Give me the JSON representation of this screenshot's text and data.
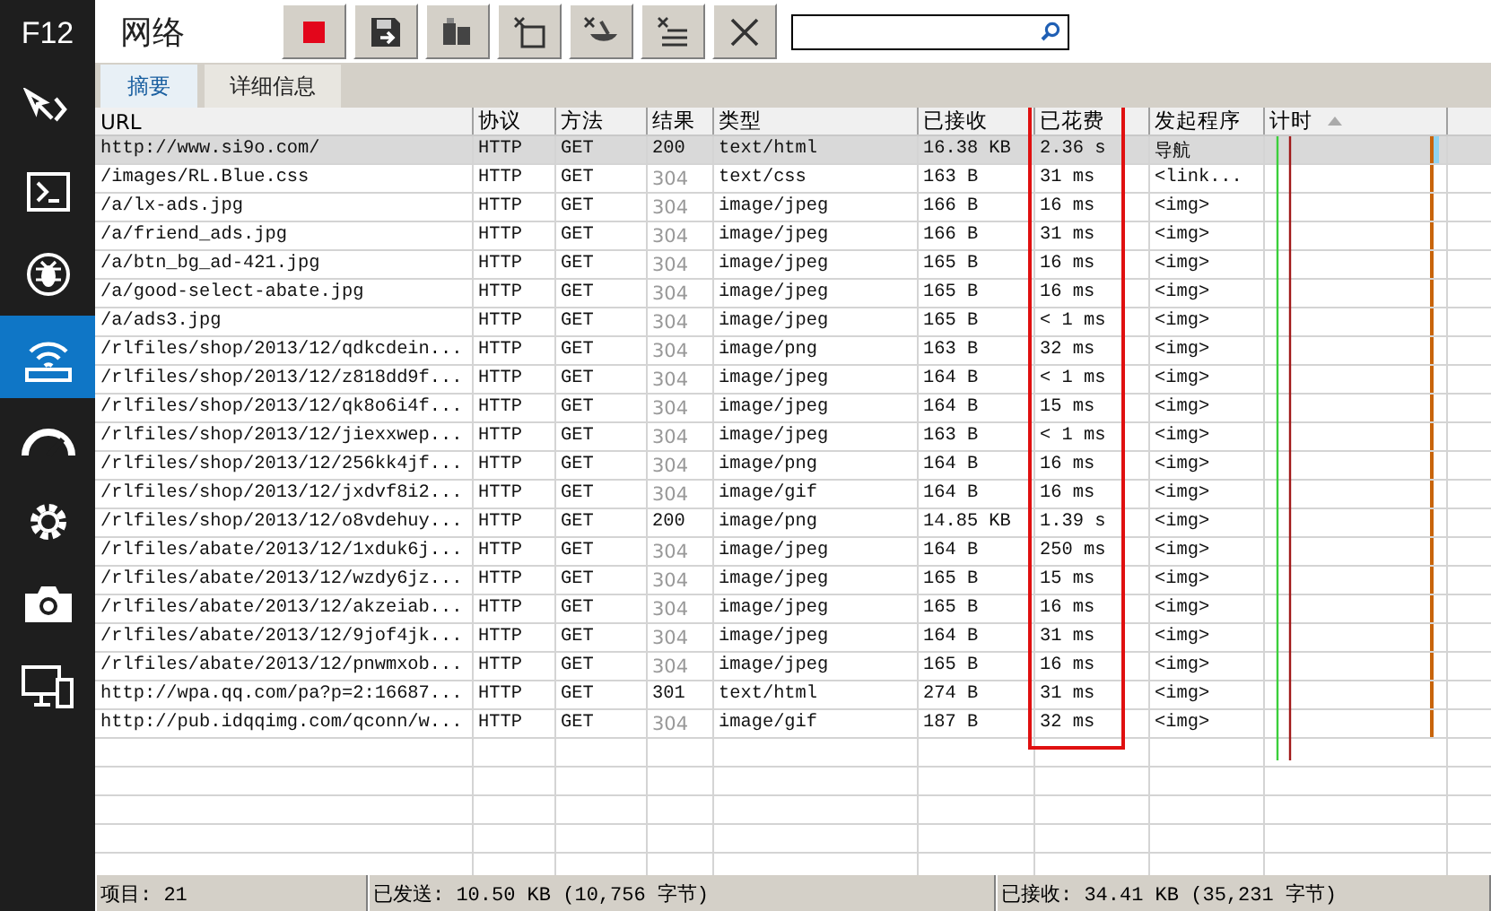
{
  "sidebar": {
    "title": "F12",
    "items": [
      {
        "selected": false
      },
      {
        "selected": false
      },
      {
        "selected": false
      },
      {
        "selected": true
      },
      {
        "selected": false
      },
      {
        "selected": false
      },
      {
        "selected": false
      },
      {
        "selected": false
      }
    ]
  },
  "header": {
    "title": "网络",
    "recording": true
  },
  "tabs": [
    {
      "label": "摘要",
      "selected": true
    },
    {
      "label": "详细信息",
      "selected": false
    }
  ],
  "table": {
    "columns": [
      "URL",
      "协议",
      "方法",
      "结果",
      "类型",
      "已接收",
      "已花费",
      "发起程序",
      "计时"
    ],
    "rows": [
      {
        "url": "http://www.si9o.com/",
        "protocol": "HTTP",
        "method": "GET",
        "result": "200",
        "cached": false,
        "type": "text/html",
        "received": "16.38 KB",
        "taken": "2.36 s",
        "initiator": "导航",
        "selected": true
      },
      {
        "url": "/images/RL.Blue.css",
        "protocol": "HTTP",
        "method": "GET",
        "result": "304",
        "cached": true,
        "type": "text/css",
        "received": "163 B",
        "taken": "31 ms",
        "initiator": "<link...",
        "selected": false
      },
      {
        "url": "/a/lx-ads.jpg",
        "protocol": "HTTP",
        "method": "GET",
        "result": "304",
        "cached": true,
        "type": "image/jpeg",
        "received": "166 B",
        "taken": "16 ms",
        "initiator": "<img>",
        "selected": false
      },
      {
        "url": "/a/friend_ads.jpg",
        "protocol": "HTTP",
        "method": "GET",
        "result": "304",
        "cached": true,
        "type": "image/jpeg",
        "received": "166 B",
        "taken": "31 ms",
        "initiator": "<img>",
        "selected": false
      },
      {
        "url": "/a/btn_bg_ad-421.jpg",
        "protocol": "HTTP",
        "method": "GET",
        "result": "304",
        "cached": true,
        "type": "image/jpeg",
        "received": "165 B",
        "taken": "16 ms",
        "initiator": "<img>",
        "selected": false
      },
      {
        "url": "/a/good-select-abate.jpg",
        "protocol": "HTTP",
        "method": "GET",
        "result": "304",
        "cached": true,
        "type": "image/jpeg",
        "received": "165 B",
        "taken": "16 ms",
        "initiator": "<img>",
        "selected": false
      },
      {
        "url": "/a/ads3.jpg",
        "protocol": "HTTP",
        "method": "GET",
        "result": "304",
        "cached": true,
        "type": "image/jpeg",
        "received": "165 B",
        "taken": "< 1 ms",
        "initiator": "<img>",
        "selected": false
      },
      {
        "url": "/rlfiles/shop/2013/12/qdkcdein...",
        "protocol": "HTTP",
        "method": "GET",
        "result": "304",
        "cached": true,
        "type": "image/png",
        "received": "163 B",
        "taken": "32 ms",
        "initiator": "<img>",
        "selected": false
      },
      {
        "url": "/rlfiles/shop/2013/12/z818dd9f...",
        "protocol": "HTTP",
        "method": "GET",
        "result": "304",
        "cached": true,
        "type": "image/jpeg",
        "received": "164 B",
        "taken": "< 1 ms",
        "initiator": "<img>",
        "selected": false
      },
      {
        "url": "/rlfiles/shop/2013/12/qk8o6i4f...",
        "protocol": "HTTP",
        "method": "GET",
        "result": "304",
        "cached": true,
        "type": "image/jpeg",
        "received": "164 B",
        "taken": "15 ms",
        "initiator": "<img>",
        "selected": false
      },
      {
        "url": "/rlfiles/shop/2013/12/jiexxwep...",
        "protocol": "HTTP",
        "method": "GET",
        "result": "304",
        "cached": true,
        "type": "image/jpeg",
        "received": "163 B",
        "taken": "< 1 ms",
        "initiator": "<img>",
        "selected": false
      },
      {
        "url": "/rlfiles/shop/2013/12/256kk4jf...",
        "protocol": "HTTP",
        "method": "GET",
        "result": "304",
        "cached": true,
        "type": "image/png",
        "received": "164 B",
        "taken": "16 ms",
        "initiator": "<img>",
        "selected": false
      },
      {
        "url": "/rlfiles/shop/2013/12/jxdvf8i2...",
        "protocol": "HTTP",
        "method": "GET",
        "result": "304",
        "cached": true,
        "type": "image/gif",
        "received": "164 B",
        "taken": "16 ms",
        "initiator": "<img>",
        "selected": false
      },
      {
        "url": "/rlfiles/shop/2013/12/o8vdehuy...",
        "protocol": "HTTP",
        "method": "GET",
        "result": "200",
        "cached": false,
        "type": "image/png",
        "received": "14.85 KB",
        "taken": "1.39 s",
        "initiator": "<img>",
        "selected": false
      },
      {
        "url": "/rlfiles/abate/2013/12/1xduk6j...",
        "protocol": "HTTP",
        "method": "GET",
        "result": "304",
        "cached": true,
        "type": "image/jpeg",
        "received": "164 B",
        "taken": "250 ms",
        "initiator": "<img>",
        "selected": false
      },
      {
        "url": "/rlfiles/abate/2013/12/wzdy6jz...",
        "protocol": "HTTP",
        "method": "GET",
        "result": "304",
        "cached": true,
        "type": "image/jpeg",
        "received": "165 B",
        "taken": "15 ms",
        "initiator": "<img>",
        "selected": false
      },
      {
        "url": "/rlfiles/abate/2013/12/akzeiab...",
        "protocol": "HTTP",
        "method": "GET",
        "result": "304",
        "cached": true,
        "type": "image/jpeg",
        "received": "165 B",
        "taken": "16 ms",
        "initiator": "<img>",
        "selected": false
      },
      {
        "url": "/rlfiles/abate/2013/12/9jof4jk...",
        "protocol": "HTTP",
        "method": "GET",
        "result": "304",
        "cached": true,
        "type": "image/jpeg",
        "received": "164 B",
        "taken": "31 ms",
        "initiator": "<img>",
        "selected": false
      },
      {
        "url": "/rlfiles/abate/2013/12/pnwmxob...",
        "protocol": "HTTP",
        "method": "GET",
        "result": "304",
        "cached": true,
        "type": "image/jpeg",
        "received": "165 B",
        "taken": "16 ms",
        "initiator": "<img>",
        "selected": false
      },
      {
        "url": "http://wpa.qq.com/pa?p=2:16687...",
        "protocol": "HTTP",
        "method": "GET",
        "result": "301",
        "cached": false,
        "type": "text/html",
        "received": "274 B",
        "taken": "31 ms",
        "initiator": "<img>",
        "selected": false
      },
      {
        "url": "http://pub.idqqimg.com/qconn/w...",
        "protocol": "HTTP",
        "method": "GET",
        "result": "304",
        "cached": true,
        "type": "image/gif",
        "received": "187 B",
        "taken": "32 ms",
        "initiator": "<img>",
        "selected": false
      }
    ]
  },
  "status_bar": [
    "项目: 21",
    "已发送: 10.50 KB (10,756 字节)",
    "已接收: 34.41 KB (35,231 字节)"
  ]
}
